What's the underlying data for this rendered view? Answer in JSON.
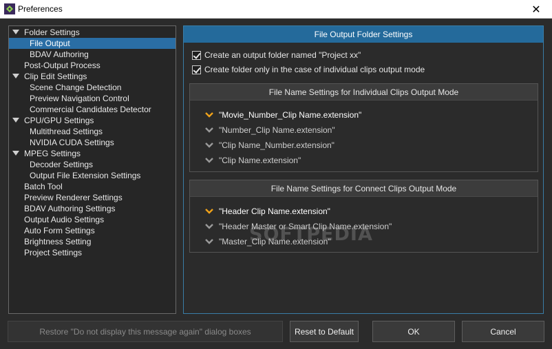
{
  "window": {
    "title": "Preferences"
  },
  "tree": [
    {
      "label": "Folder Settings",
      "level": 0,
      "expanded": true
    },
    {
      "label": "File Output",
      "level": 1,
      "selected": true
    },
    {
      "label": "BDAV Authoring",
      "level": 1
    },
    {
      "label": "Post-Output Process",
      "level": 0
    },
    {
      "label": "Clip Edit Settings",
      "level": 0,
      "expanded": true
    },
    {
      "label": "Scene Change Detection",
      "level": 1
    },
    {
      "label": "Preview Navigation Control",
      "level": 1
    },
    {
      "label": "Commercial Candidates Detector",
      "level": 1
    },
    {
      "label": "CPU/GPU Settings",
      "level": 0,
      "expanded": true
    },
    {
      "label": "Multithread Settings",
      "level": 1
    },
    {
      "label": "NVIDIA CUDA Settings",
      "level": 1
    },
    {
      "label": "MPEG Settings",
      "level": 0,
      "expanded": true
    },
    {
      "label": "Decoder Settings",
      "level": 1
    },
    {
      "label": "Output File Extension Settings",
      "level": 1
    },
    {
      "label": "Batch Tool",
      "level": 0
    },
    {
      "label": "Preview Renderer Settings",
      "level": 0
    },
    {
      "label": "BDAV Authoring Settings",
      "level": 0
    },
    {
      "label": "Output Audio Settings",
      "level": 0
    },
    {
      "label": "Auto Form Settings",
      "level": 0
    },
    {
      "label": "Brightness Setting",
      "level": 0
    },
    {
      "label": "Project Settings",
      "level": 0
    }
  ],
  "panel": {
    "title": "File Output Folder Settings",
    "checkboxes": [
      {
        "label": "Create an output folder named \"Project xx\"",
        "checked": true
      },
      {
        "label": "Create folder only in the case of individual clips output mode",
        "checked": true
      }
    ],
    "individual": {
      "title": "File Name Settings for Individual Clips Output Mode",
      "options": [
        "\"Movie_Number_Clip Name.extension\"",
        "\"Number_Clip Name.extension\"",
        "\"Clip Name_Number.extension\"",
        "\"Clip Name.extension\""
      ],
      "selected_index": 0
    },
    "connect": {
      "title": "File Name Settings for Connect Clips Output Mode",
      "options": [
        "\"Header Clip Name.extension\"",
        "\"Header Master or Smart Clip Name.extension\"",
        "\"Master_Clip Name.extension\""
      ],
      "selected_index": 0
    }
  },
  "watermark": "SOFTPEDIA",
  "buttons": {
    "restore": "Restore \"Do not display this message again\" dialog boxes",
    "reset": "Reset to Default",
    "ok": "OK",
    "cancel": "Cancel"
  },
  "colors": {
    "accent": "#246a9b",
    "selection": "#2a6ea5",
    "active_chevron": "#f0a21a",
    "inactive_chevron": "#9a9a9a"
  }
}
